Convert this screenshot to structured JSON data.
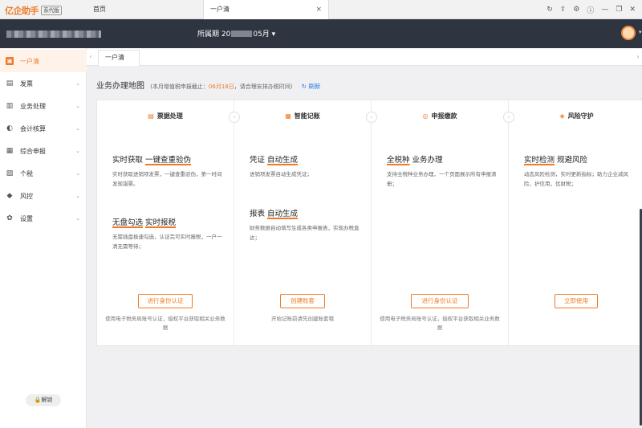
{
  "browser": {
    "logo_text": "亿企助手",
    "version_badge": "系代版",
    "tabs": [
      {
        "label": "首页"
      },
      {
        "label": "一户清"
      }
    ],
    "close_glyph": "×",
    "controls": [
      "↻",
      "⇪",
      "⚙",
      "ⓘ",
      "—",
      "❐",
      "✕"
    ]
  },
  "header": {
    "period_label": "所属期",
    "period_prefix": "20",
    "period_suffix": "05月",
    "period_caret": "▾"
  },
  "sidebar": {
    "items": [
      {
        "label": "一户清",
        "icon": "▣",
        "active": true
      },
      {
        "label": "发票",
        "icon": "▤"
      },
      {
        "label": "业务处理",
        "icon": "▥"
      },
      {
        "label": "会计核算",
        "icon": "◐"
      },
      {
        "label": "综合申报",
        "icon": "▦"
      },
      {
        "label": "个税",
        "icon": "▧"
      },
      {
        "label": "风控",
        "icon": "◆"
      },
      {
        "label": "设置",
        "icon": "✿"
      }
    ],
    "chevron": "⌄",
    "unlock_label": "🔒解锁"
  },
  "content": {
    "subtab_label": "一户清",
    "left_arrow": "‹",
    "right_arrow": "›",
    "title": "业务办理地图",
    "note_prefix": "(本月增值税申报截止：",
    "note_date": "06月18日",
    "note_suffix": "，请合理安排办税时间)",
    "refresh_label": "↻ 刷新"
  },
  "columns": [
    {
      "head": "票据处理",
      "icon": "▤",
      "features": [
        {
          "title_a": "实时获取",
          "title_b": "一键查重验伪",
          "desc": "实时获取进销项发票，一键查重验伪，第一时间发现错票。"
        },
        {
          "title_a": "无盘勾选",
          "title_b": "实时报税",
          "desc": "无需插盘极速勾选，认证完可实时报税，一户一清无需等待；"
        }
      ],
      "button": "进行身份认证",
      "hint": "使用电子税务局账号认证，授权平台获取相关业务数据"
    },
    {
      "head": "智能记账",
      "icon": "▦",
      "features": [
        {
          "title_a": "凭证",
          "title_b": "自动生成",
          "desc": "进销项发票自动生成凭证；"
        },
        {
          "title_a": "报表",
          "title_b": "自动生成",
          "desc": "财务数据自动填写生成各类申报表，实现办税直达；"
        }
      ],
      "button": "创建账套",
      "hint": "开始记账前请先创建账套哦"
    },
    {
      "head": "申报缴款",
      "icon": "◎",
      "features": [
        {
          "title_a": "全税种",
          "title_b": "业务办理",
          "desc": "支持全税种业务办理，一个页面展示所有申报清册；"
        }
      ],
      "button": "进行身份认证",
      "hint": "使用电子税务局账号认证，授权平台获取相关业务数据"
    },
    {
      "head": "风险守护",
      "icon": "◈",
      "features": [
        {
          "title_a": "实时检测",
          "title_b": "规避风险",
          "desc": "动态风险检测，实时更新指标；助力企业减风险，护信用，优财税；"
        }
      ],
      "button": "立即使用",
      "hint": ""
    }
  ],
  "colors": {
    "accent": "#ef7a26",
    "header_bg": "#2f3441",
    "link_blue": "#2d7be6"
  }
}
